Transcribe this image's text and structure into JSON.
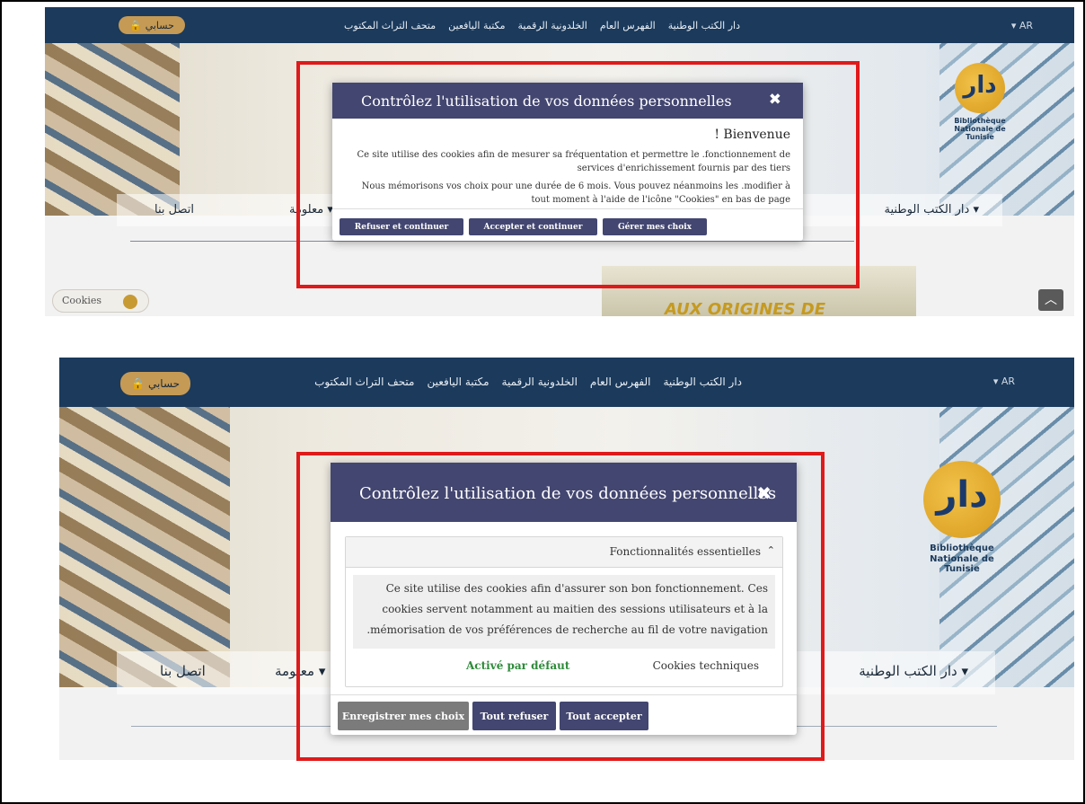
{
  "colors": {
    "nav": "#1b3a5c",
    "modal_header": "#434670",
    "highlight": "#e01a1a",
    "enabled_green": "#2e8b3a",
    "account_button": "#c59a55"
  },
  "nav": {
    "lang": "▾ AR",
    "links": [
      "دار الكتب الوطنية",
      "الفهرس العام",
      "الخلدونية الرقمية",
      "مكتبة اليافعين",
      "متحف التراث المكتوب"
    ],
    "account_label": "حسابي",
    "account_icon": "lock-icon"
  },
  "logo": {
    "name": "Bibliothèque Nationale de Tunisie"
  },
  "menu": {
    "contact": "اتصل بنا",
    "info": "معلومة ▾",
    "dar": "دار الكتب الوطنية ▾"
  },
  "cookies_button": "Cookies",
  "book_text": "AUX ORIGINES DE",
  "modal1": {
    "title": "Contrôlez l'utilisation de vos données personnelles",
    "welcome": "! Bienvenue",
    "para1": "Ce site utilise des cookies afin de mesurer sa fréquentation et permettre le .fonctionnement de services d'enrichissement fournis par des tiers",
    "para2": "Nous mémorisons vos choix pour une durée de 6 mois. Vous pouvez néanmoins les .modifier à tout moment à l'aide de l'icône \"Cookies\" en bas de page",
    "buttons": {
      "refuse": "Refuser et continuer",
      "accept": "Accepter et continuer",
      "manage": "Gérer mes choix"
    }
  },
  "modal2": {
    "title": "Contrôlez l'utilisation de vos données personnelles",
    "section_title": "Fonctionnalités essentielles",
    "description": "Ce site utilise des cookies afin d'assurer son bon fonctionnement. Ces cookies servent notamment au maitien des sessions utilisateurs et à la .mémorisation de vos préférences de recherche au fil de votre navigation",
    "status": "Activé par défaut",
    "cookie_name": "Cookies techniques",
    "buttons": {
      "save": "Enregistrer mes choix",
      "refuse_all": "Tout refuser",
      "accept_all": "Tout accepter"
    }
  }
}
